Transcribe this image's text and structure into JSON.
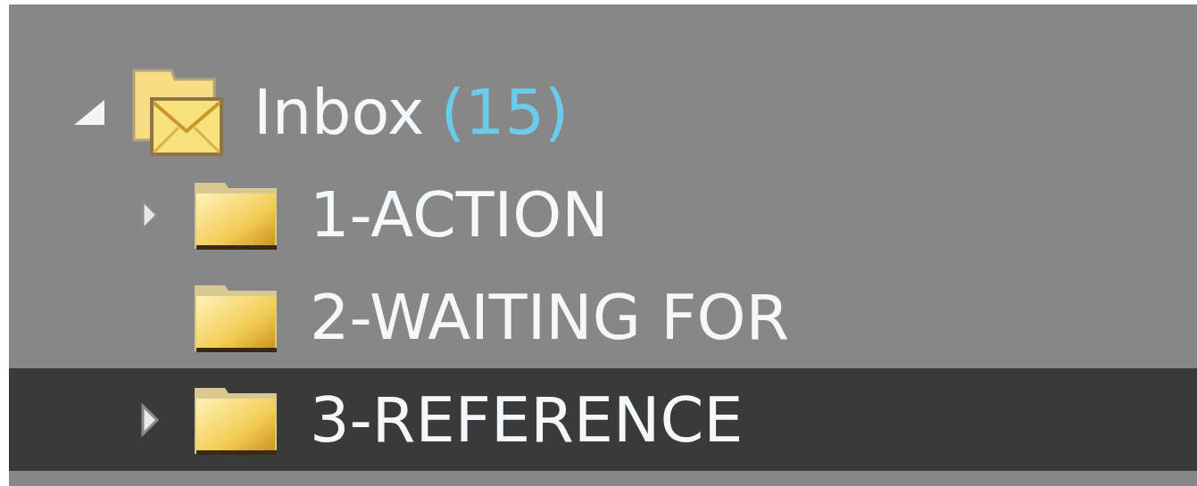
{
  "folders": [
    {
      "name": "Inbox",
      "count": "(15)",
      "kind": "inbox",
      "expanded": true,
      "has_children": true,
      "selected": false,
      "children": [
        {
          "name": "1-ACTION",
          "kind": "folder",
          "expanded": false,
          "has_children": true,
          "selected": false
        },
        {
          "name": "2-WAITING FOR",
          "kind": "folder",
          "expanded": false,
          "has_children": false,
          "selected": false
        },
        {
          "name": "3-REFERENCE",
          "kind": "folder",
          "expanded": false,
          "has_children": true,
          "selected": true
        }
      ]
    }
  ]
}
